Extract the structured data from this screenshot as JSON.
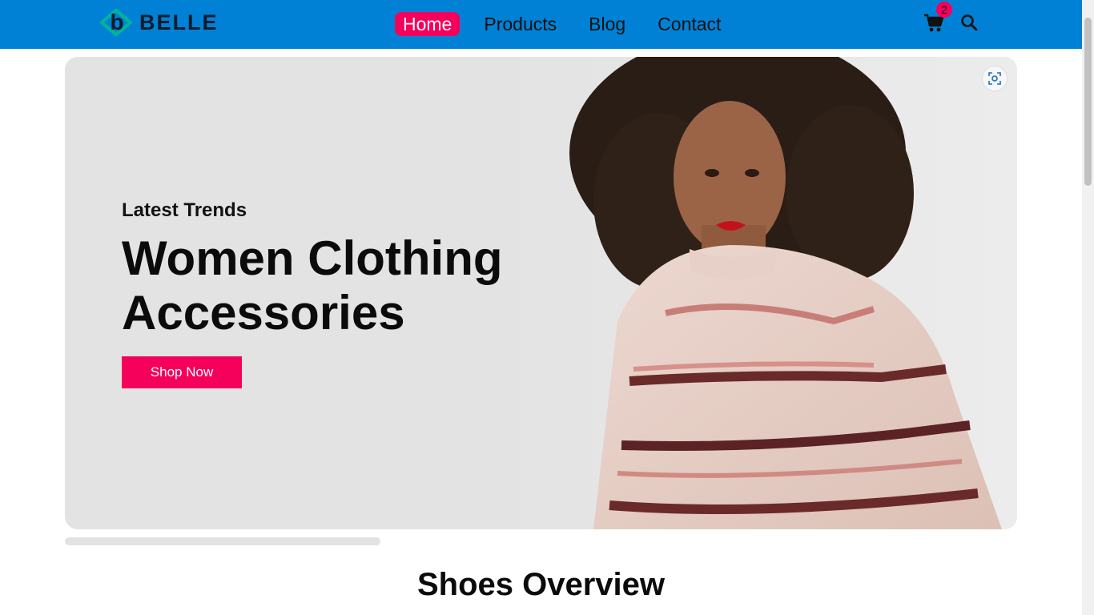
{
  "brand": {
    "name": "BELLE",
    "logo_letter": "b"
  },
  "nav": {
    "items": [
      {
        "label": "Home",
        "active": true
      },
      {
        "label": "Products",
        "active": false
      },
      {
        "label": "Blog",
        "active": false
      },
      {
        "label": "Contact",
        "active": false
      }
    ]
  },
  "header_actions": {
    "cart_icon": "cart-icon",
    "cart_count": "2",
    "search_icon": "search-icon"
  },
  "hero": {
    "eyebrow": "Latest Trends",
    "title_line1": "Women Clothing",
    "title_line2": "Accessories",
    "cta_label": "Shop Now",
    "scan_icon": "visual-search-icon"
  },
  "section": {
    "title": "Shoes Overview"
  },
  "colors": {
    "header_bg": "#0081d5",
    "accent": "#f5005a",
    "hero_bg": "#e3e3e3",
    "logo_teal": "#00b39b"
  }
}
